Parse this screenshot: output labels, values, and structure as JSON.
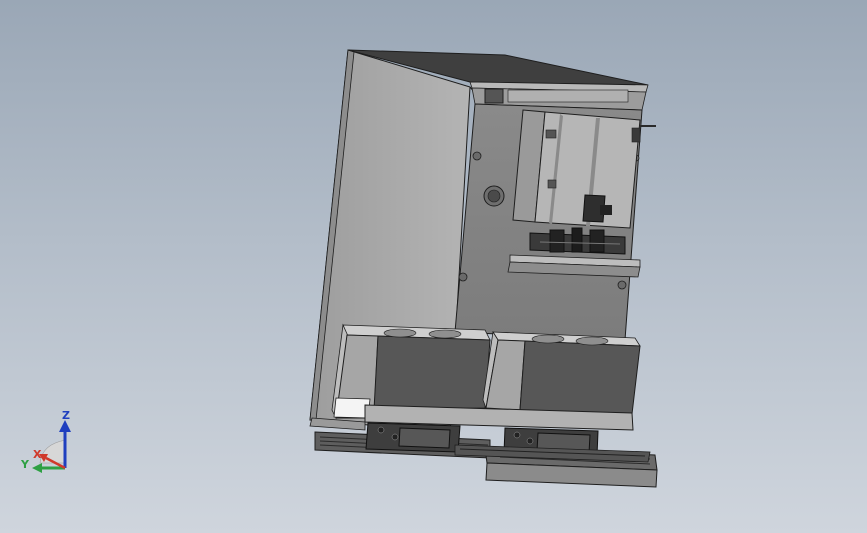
{
  "viewport": {
    "background_top": "#9aa7b6",
    "background_bottom": "#cfd5dd"
  },
  "model": {
    "part_fill_light": "#a9a9a9",
    "part_fill_mid": "#8e8e8e",
    "part_fill_dark": "#4e4e4e",
    "edge_color": "#1e1e1e",
    "icon": "cad-assembly-icon"
  },
  "triad": {
    "icon": "axis-triad-icon",
    "z_label": "Z",
    "y_label": "Y",
    "x_label": "X",
    "z_color": "#1f3fbf",
    "y_color": "#2ea043",
    "x_color": "#d0392b"
  }
}
